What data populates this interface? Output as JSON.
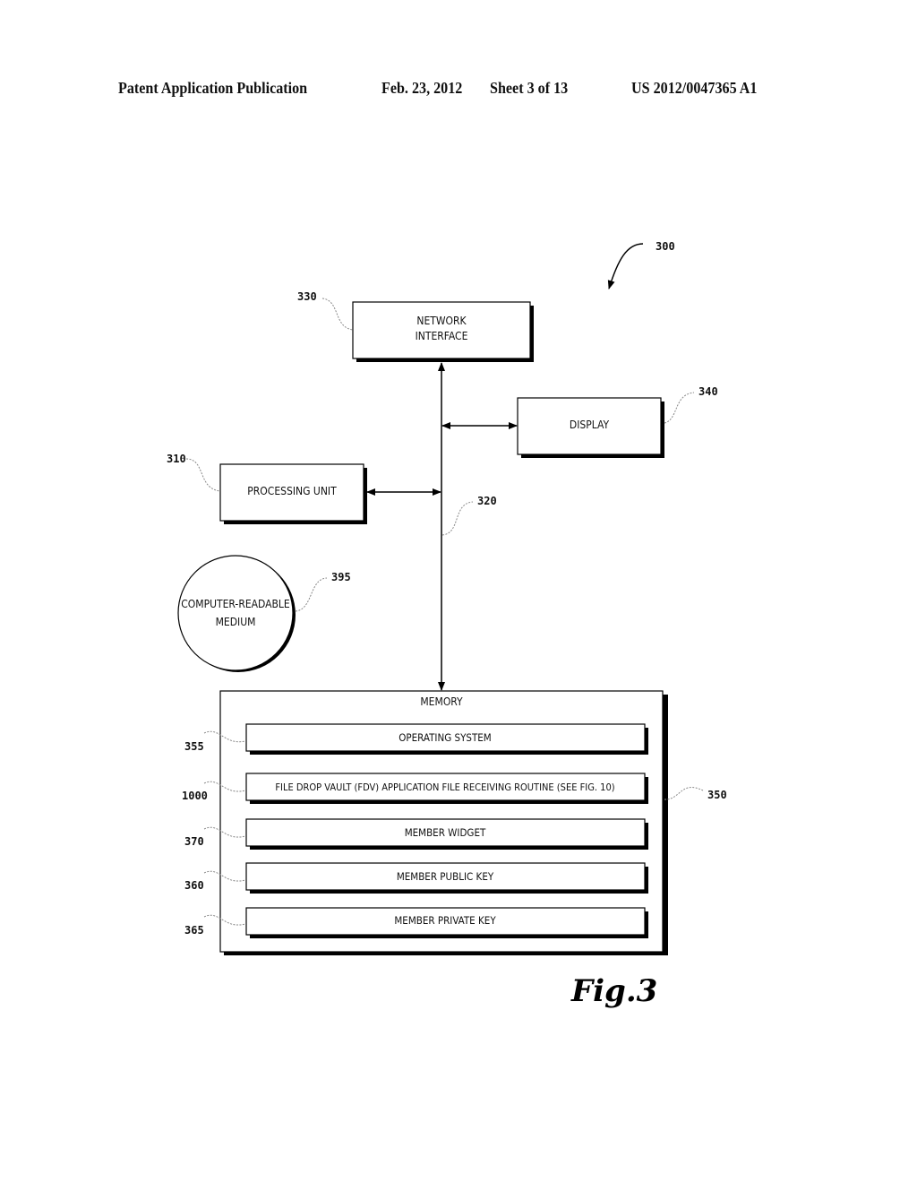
{
  "header": {
    "publication": "Patent Application Publication",
    "date": "Feb. 23, 2012",
    "sheet": "Sheet 3 of 13",
    "number": "US 2012/0047365 A1"
  },
  "diagram": {
    "ref": "300",
    "components": {
      "network_interface": {
        "label_line1": "NETWORK",
        "label_line2": "INTERFACE",
        "ref": "330"
      },
      "display": {
        "label": "DISPLAY",
        "ref": "340"
      },
      "processing_unit": {
        "label": "PROCESSING UNIT",
        "ref": "310"
      },
      "bus": {
        "ref": "320"
      },
      "medium": {
        "label_line1": "COMPUTER-READABLE",
        "label_line2": "MEDIUM",
        "ref": "395"
      },
      "memory": {
        "label": "MEMORY",
        "ref": "350",
        "items": [
          {
            "label": "OPERATING SYSTEM",
            "ref": "355"
          },
          {
            "label": "FILE DROP VAULT (FDV) APPLICATION FILE RECEIVING ROUTINE (SEE FIG. 10)",
            "ref": "1000"
          },
          {
            "label": "MEMBER WIDGET",
            "ref": "370"
          },
          {
            "label": "MEMBER PUBLIC KEY",
            "ref": "360"
          },
          {
            "label": "MEMBER PRIVATE KEY",
            "ref": "365"
          }
        ]
      }
    },
    "figure_label": "Fig.3"
  }
}
